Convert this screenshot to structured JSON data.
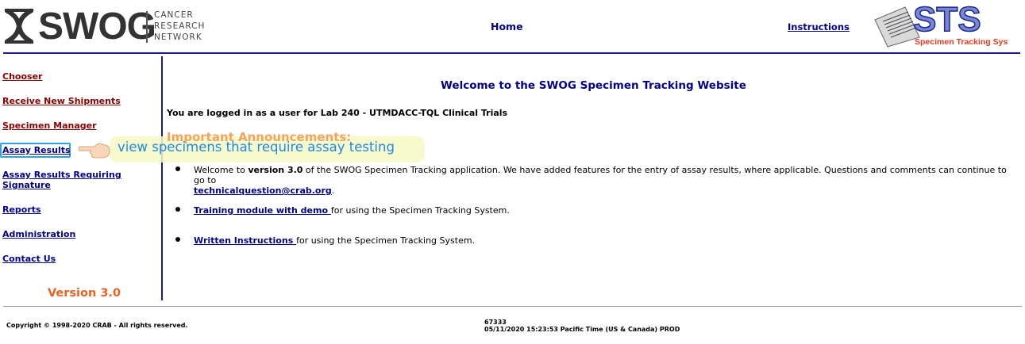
{
  "header": {
    "logo_text": "SWOG",
    "logo_sub": [
      "CANCER",
      "RESEARCH",
      "NETWORK"
    ],
    "home_label": "Home",
    "instructions_label": "Instructions",
    "sts_logo_text": "STS",
    "sts_logo_sub": "Specimen Tracking System"
  },
  "sidebar": {
    "items": [
      {
        "label": "Chooser"
      },
      {
        "label": "Receive New Shipments"
      },
      {
        "label": "Specimen Manager"
      },
      {
        "label": "Assay Results"
      },
      {
        "label": "Assay Results Requiring Signature"
      },
      {
        "label": "Reports"
      },
      {
        "label": "Administration"
      },
      {
        "label": "Contact Us"
      }
    ],
    "version": "Version 3.0"
  },
  "callout": {
    "text": "view specimens that require assay testing"
  },
  "main": {
    "welcome": "Welcome to the SWOG Specimen Tracking Website",
    "logged_in": "You are logged in as a user for Lab 240 - UTMDACC-TQL Clinical Trials",
    "important_heading": "Important Announcements:",
    "announcements": [
      {
        "pre": "Welcome to ",
        "bold": "version 3.0",
        "post": " of the SWOG Specimen Tracking application. We have added features for the entry of assay results, where applicable. Questions and comments can continue to go to ",
        "link": "technicalquestion@crab.org",
        "end": "."
      },
      {
        "link": "Training module with demo ",
        "post": "for using the Specimen Tracking System."
      },
      {
        "link": "Written Instructions ",
        "post": "for using the Specimen Tracking System."
      }
    ]
  },
  "footer": {
    "copyright": "Copyright © 1998-2020 CRAB - All rights reserved.",
    "code": "67333",
    "timestamp": "05/11/2020 15:23:53 Pacific Time (US & Canada)   PROD"
  },
  "colors": {
    "nav_link": "#8b0000",
    "nav_link_blue": "#00008b",
    "version": "#e8641e",
    "callout_text": "#1e88e5",
    "rule": "#1a1a8c"
  }
}
